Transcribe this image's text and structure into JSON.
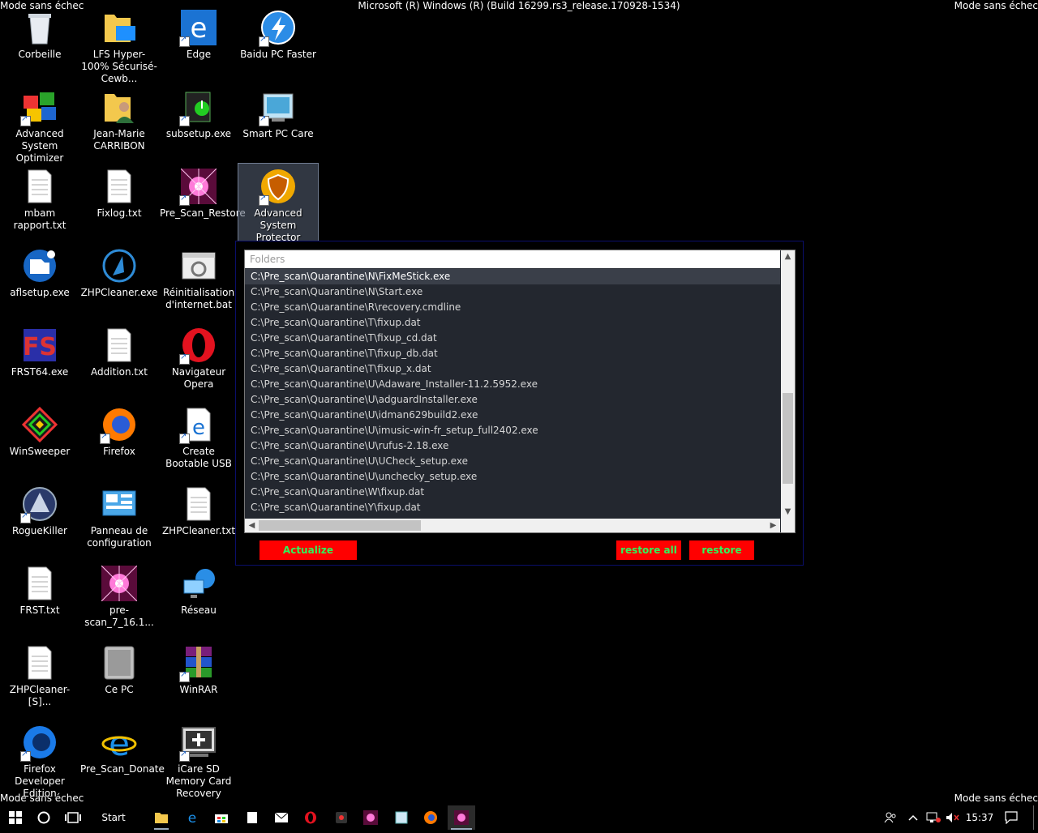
{
  "title_bar": {
    "safe_mode_top_left": "Mode sans échec",
    "safe_mode_top_right": "Mode sans échec",
    "build": "Microsoft (R) Windows (R) (Build 16299.rs3_release.170928-1534)",
    "safe_mode_bottom_left": "Mode sans échec",
    "safe_mode_bottom_right": "Mode sans échec"
  },
  "desktop_icons": [
    {
      "label": "Corbeille",
      "icon": "recycle-bin-icon"
    },
    {
      "label": "LFS Hyper-100% Sécurisé-Cewb...",
      "icon": "folder-icon"
    },
    {
      "label": "Edge",
      "icon": "edge-icon"
    },
    {
      "label": "Baidu PC Faster",
      "icon": "baidu-pc-faster-icon"
    },
    {
      "label": "Advanced System Optimizer",
      "icon": "advanced-system-optimizer-icon"
    },
    {
      "label": "Jean-Marie CARRIBON",
      "icon": "user-folder-icon"
    },
    {
      "label": "subsetup.exe",
      "icon": "installer-icon"
    },
    {
      "label": "Smart PC Care",
      "icon": "smart-pc-care-icon"
    },
    {
      "label": "mbam rapport.txt",
      "icon": "text-file-icon"
    },
    {
      "label": "Fixlog.txt",
      "icon": "text-file-icon"
    },
    {
      "label": "Pre_Scan_Restore",
      "icon": "pre-scan-icon"
    },
    {
      "label": "Advanced System Protector",
      "icon": "shield-icon"
    },
    {
      "label": "aflsetup.exe",
      "icon": "installer-icon"
    },
    {
      "label": "ZHPCleaner.exe",
      "icon": "zhpcleaner-icon"
    },
    {
      "label": "Réinitialisation d'internet.bat",
      "icon": "batch-file-icon"
    },
    {
      "label": "FRST64.exe",
      "icon": "frst-icon"
    },
    {
      "label": "Addition.txt",
      "icon": "text-file-icon"
    },
    {
      "label": "Navigateur Opera",
      "icon": "opera-icon"
    },
    {
      "label": "WinSweeper",
      "icon": "winsweeper-icon"
    },
    {
      "label": "Firefox",
      "icon": "firefox-icon"
    },
    {
      "label": "Create Bootable USB",
      "icon": "edge-file-icon"
    },
    {
      "label": "RogueKiller",
      "icon": "roguekiller-icon"
    },
    {
      "label": "Panneau de configuration",
      "icon": "control-panel-icon"
    },
    {
      "label": "ZHPCleaner.txt",
      "icon": "text-file-icon"
    },
    {
      "label": "FRST.txt",
      "icon": "text-file-icon"
    },
    {
      "label": "pre-scan_7_16.1...",
      "icon": "pre-scan-icon"
    },
    {
      "label": "Réseau",
      "icon": "network-icon"
    },
    {
      "label": "ZHPCleaner-[S]...",
      "icon": "text-file-icon"
    },
    {
      "label": "Ce PC",
      "icon": "computer-icon"
    },
    {
      "label": "WinRAR",
      "icon": "winrar-icon"
    },
    {
      "label": "Firefox Developer Edition",
      "icon": "firefox-dev-icon"
    },
    {
      "label": "Pre_Scan_Donate",
      "icon": "internet-explorer-icon"
    },
    {
      "label": "iCare SD Memory Card Recovery",
      "icon": "icare-icon"
    }
  ],
  "restore_window": {
    "list_header": "Folders",
    "rows": [
      "C:\\Pre_scan\\Quarantine\\N\\FixMeStick.exe",
      "C:\\Pre_scan\\Quarantine\\N\\Start.exe",
      "C:\\Pre_scan\\Quarantine\\R\\recovery.cmdline",
      "C:\\Pre_scan\\Quarantine\\T\\fixup.dat",
      "C:\\Pre_scan\\Quarantine\\T\\fixup_cd.dat",
      "C:\\Pre_scan\\Quarantine\\T\\fixup_db.dat",
      "C:\\Pre_scan\\Quarantine\\T\\fixup_x.dat",
      "C:\\Pre_scan\\Quarantine\\U\\Adaware_Installer-11.2.5952.exe",
      "C:\\Pre_scan\\Quarantine\\U\\adguardInstaller.exe",
      "C:\\Pre_scan\\Quarantine\\U\\idman629build2.exe",
      "C:\\Pre_scan\\Quarantine\\U\\imusic-win-fr_setup_full2402.exe",
      "C:\\Pre_scan\\Quarantine\\U\\rufus-2.18.exe",
      "C:\\Pre_scan\\Quarantine\\U\\UCheck_setup.exe",
      "C:\\Pre_scan\\Quarantine\\U\\unchecky_setup.exe",
      "C:\\Pre_scan\\Quarantine\\W\\fixup.dat",
      "C:\\Pre_scan\\Quarantine\\Y\\fixup.dat"
    ],
    "selected_index": 0,
    "buttons": {
      "actualize": "Actualize",
      "restore_all": "restore all",
      "restore": "restore"
    },
    "button_color": "#ff0000",
    "button_text_color": "#2ff55a"
  },
  "taskbar": {
    "start_label": "Start",
    "clock": "15:37"
  }
}
